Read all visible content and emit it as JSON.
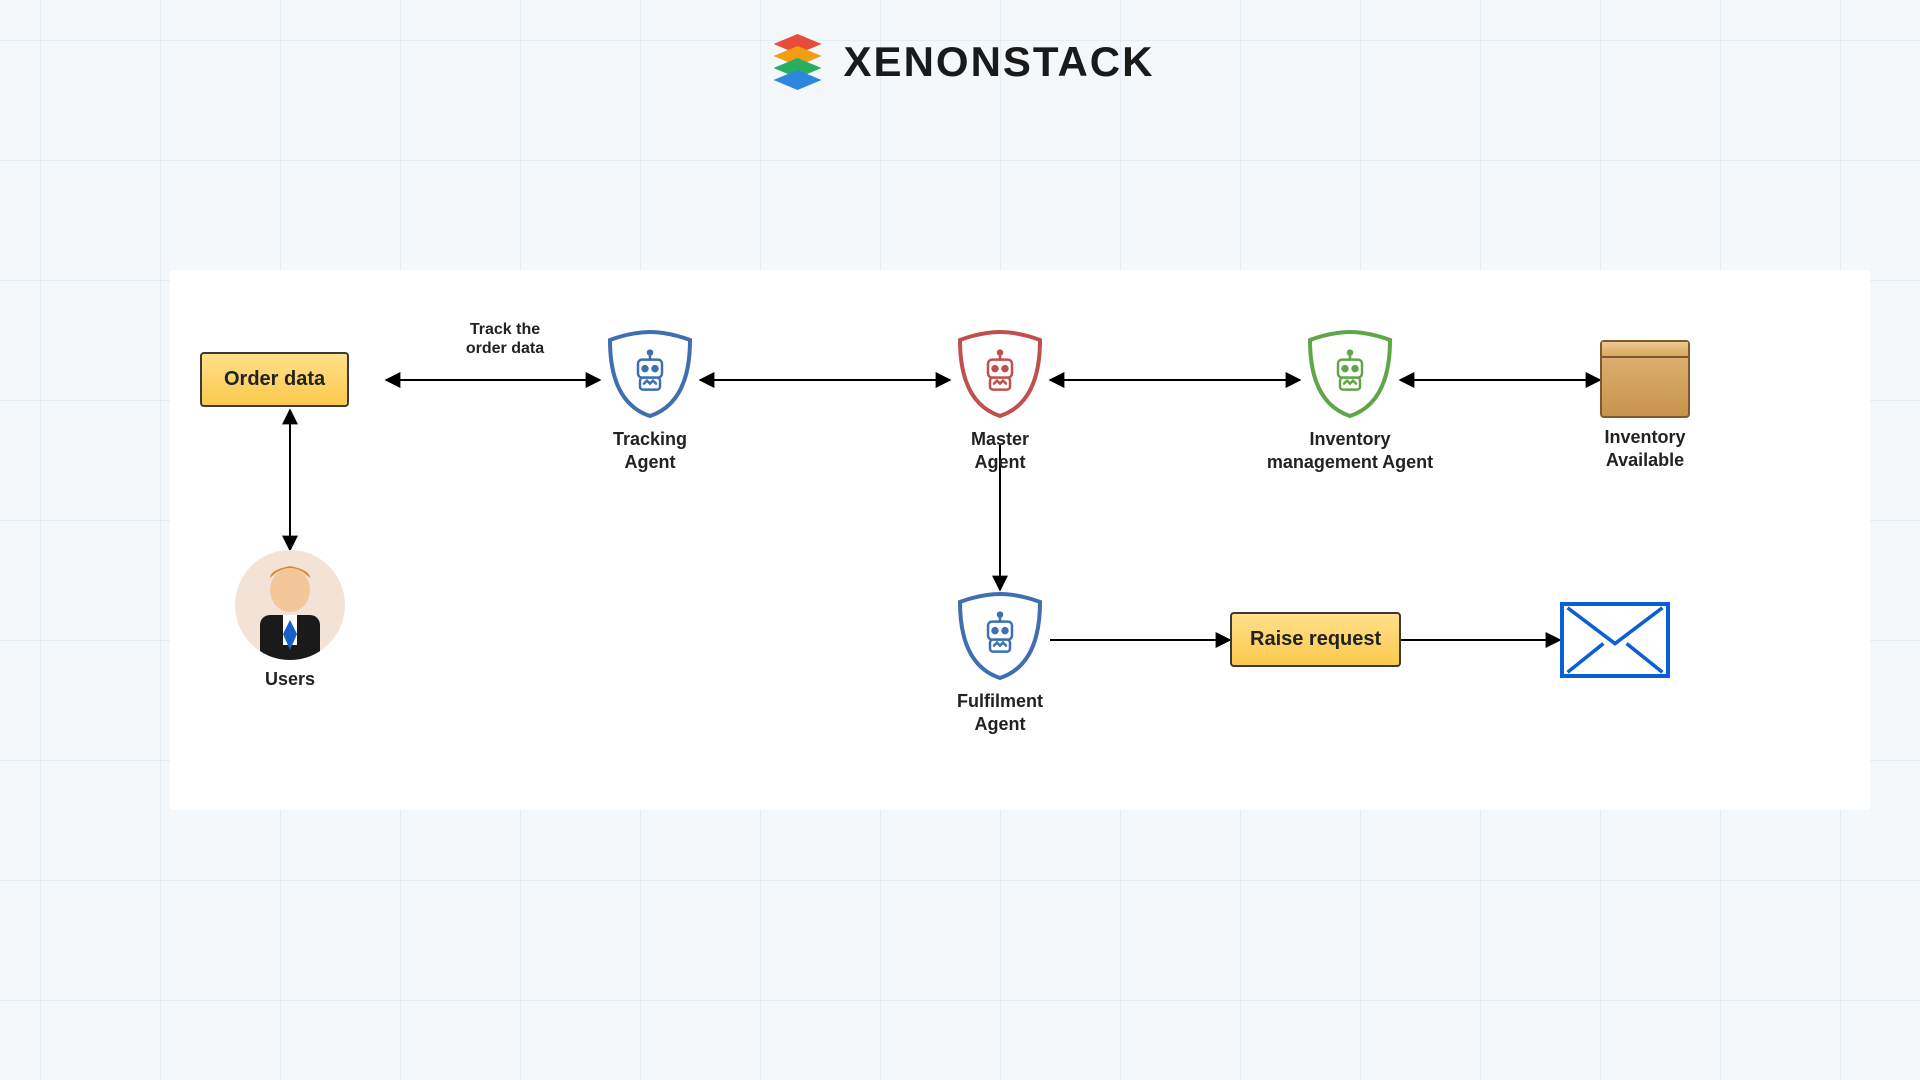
{
  "brand": {
    "name": "XENONSTACK"
  },
  "nodes": {
    "order_data": {
      "label": "Order data"
    },
    "users": {
      "label": "Users"
    },
    "tracking": {
      "label": "Tracking\nAgent"
    },
    "master": {
      "label": "Master\nAgent"
    },
    "inventory_mgmt": {
      "label": "Inventory\nmanagement Agent"
    },
    "inventory_avail": {
      "label": "Inventory\nAvailable"
    },
    "fulfilment": {
      "label": "Fulfilment\nAgent"
    },
    "raise_request": {
      "label": "Raise request"
    }
  },
  "edges": {
    "track_order": {
      "label": "Track the\norder data"
    }
  },
  "colors": {
    "shield_blue": "#3f6fb0",
    "shield_red": "#c0504d",
    "shield_green": "#5fa648",
    "accent_yellow": "#fbc94d",
    "envelope_blue": "#0b5fd6"
  }
}
